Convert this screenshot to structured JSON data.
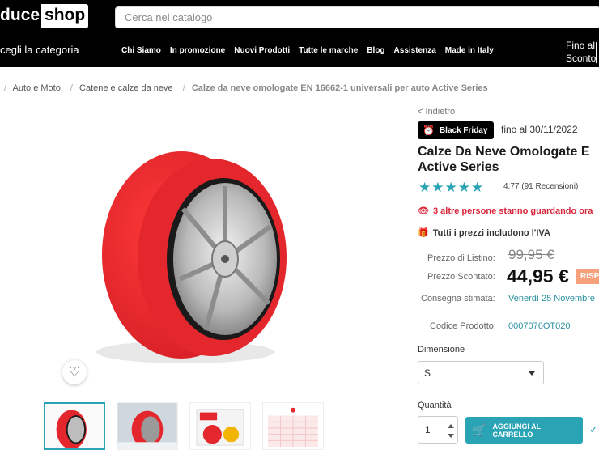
{
  "header": {
    "logo_part1": "duce",
    "logo_part2": "shop",
    "search_placeholder": "Cerca nel catalogo",
    "category_label": "cegli la categoria",
    "nav": [
      "Chi Siamo",
      "In promozione",
      "Nuovi Prodotti",
      "Tutte le marche",
      "Blog",
      "Assistenza",
      "Made in Italy"
    ],
    "promo_line1": "Fino al",
    "promo_line2": "Sconto"
  },
  "breadcrumb": {
    "items": [
      "Auto e Moto",
      "Catene e calze da neve"
    ],
    "current": "Calze da neve omologate EN 16662-1 universali per auto Active Series"
  },
  "product": {
    "back_label": "< Indietro",
    "badge_label": "Black Friday",
    "badge_until": "fino al 30/11/2022",
    "title": "Calze Da Neve Omologate E Active Series",
    "stars": "★★★★★",
    "rating_text": "4.77 (91 Recensioni)",
    "rating_value": 4.77,
    "watching_text": "3 altre persone stanno guardando ora",
    "vat_text": "Tutti i prezzi includono l'IVA",
    "list_price_label": "Prezzo di Listino:",
    "list_price": "99,95 €",
    "sale_price_label": "Prezzo Scontato:",
    "sale_price": "44,95 €",
    "save_tag": "RISP",
    "delivery_label": "Consegna stimata:",
    "delivery_value": "Venerdì 25 Novembre",
    "code_label": "Codice Prodotto:",
    "code_value": "0007076OT020",
    "dimension_label": "Dimensione",
    "dimension_value": "S",
    "quantity_label": "Quantità",
    "quantity_value": "1",
    "add_to_cart_label": "AGGIUNGI AL CARRELLO"
  },
  "icons": {
    "favorite": "heart-icon",
    "badge": "alarm-clock-icon",
    "watching": "eye-icon",
    "vat": "gift-icon",
    "cart": "cart-icon"
  },
  "colors": {
    "accent": "#2aa4b5",
    "alert": "#d9263a",
    "sock_red": "#e8272e",
    "header_bg": "#000000"
  }
}
